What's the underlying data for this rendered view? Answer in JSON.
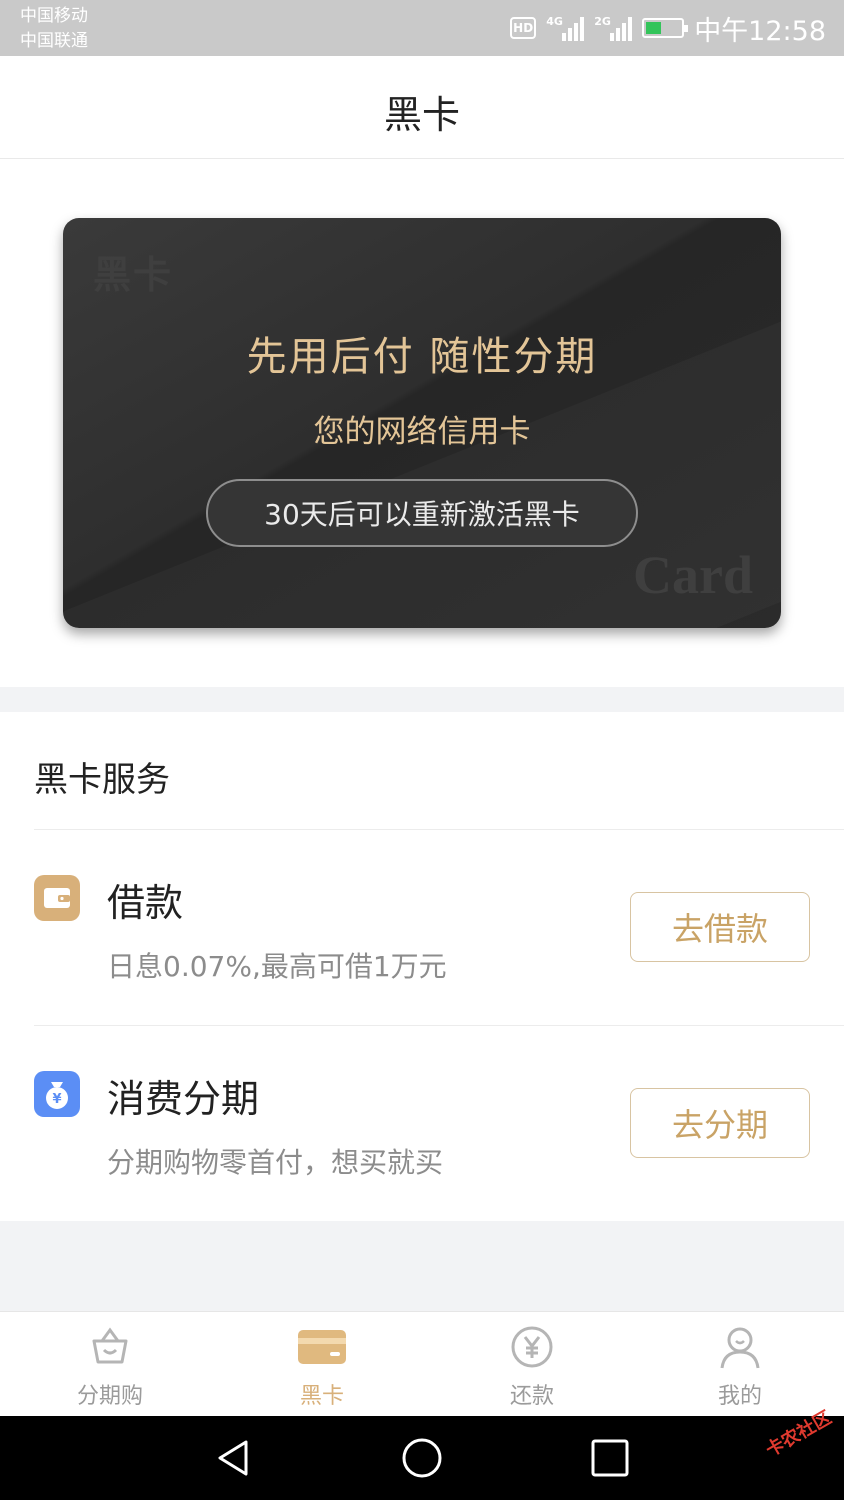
{
  "status_bar": {
    "carrier_1": "中国移动",
    "carrier_2": "中国联通",
    "hd": "HD",
    "net_1": "4G",
    "net_2": "2G",
    "time": "中午12:58",
    "battery_level": 0.45,
    "battery_color": "#33c45a"
  },
  "header": {
    "title": "黑卡"
  },
  "card": {
    "watermark_top": "黑卡",
    "watermark_bottom": "Card",
    "headline": "先用后付 随性分期",
    "subtitle": "您的网络信用卡",
    "status_button": "30天后可以重新激活黑卡",
    "accent_color": "#e3c597"
  },
  "services": {
    "title": "黑卡服务",
    "items": [
      {
        "icon": "wallet-icon",
        "name": "借款",
        "desc": "日息0.07%,最高可借1万元",
        "action": "去借款",
        "icon_color": "#d8b07a"
      },
      {
        "icon": "money-bag-icon",
        "name": "消费分期",
        "desc": "分期购物零首付，想买就买",
        "action": "去分期",
        "icon_color": "#5b8ef5"
      }
    ]
  },
  "tabbar": {
    "items": [
      {
        "label": "分期购",
        "icon": "basket-icon",
        "active": false
      },
      {
        "label": "黑卡",
        "icon": "card-icon",
        "active": true
      },
      {
        "label": "还款",
        "icon": "yen-icon",
        "active": false
      },
      {
        "label": "我的",
        "icon": "user-icon",
        "active": false
      }
    ],
    "active_color": "#d8b07a"
  },
  "system_nav": [
    "back-icon",
    "home-icon",
    "recents-icon"
  ],
  "watermark_stamp": "卡农社区"
}
